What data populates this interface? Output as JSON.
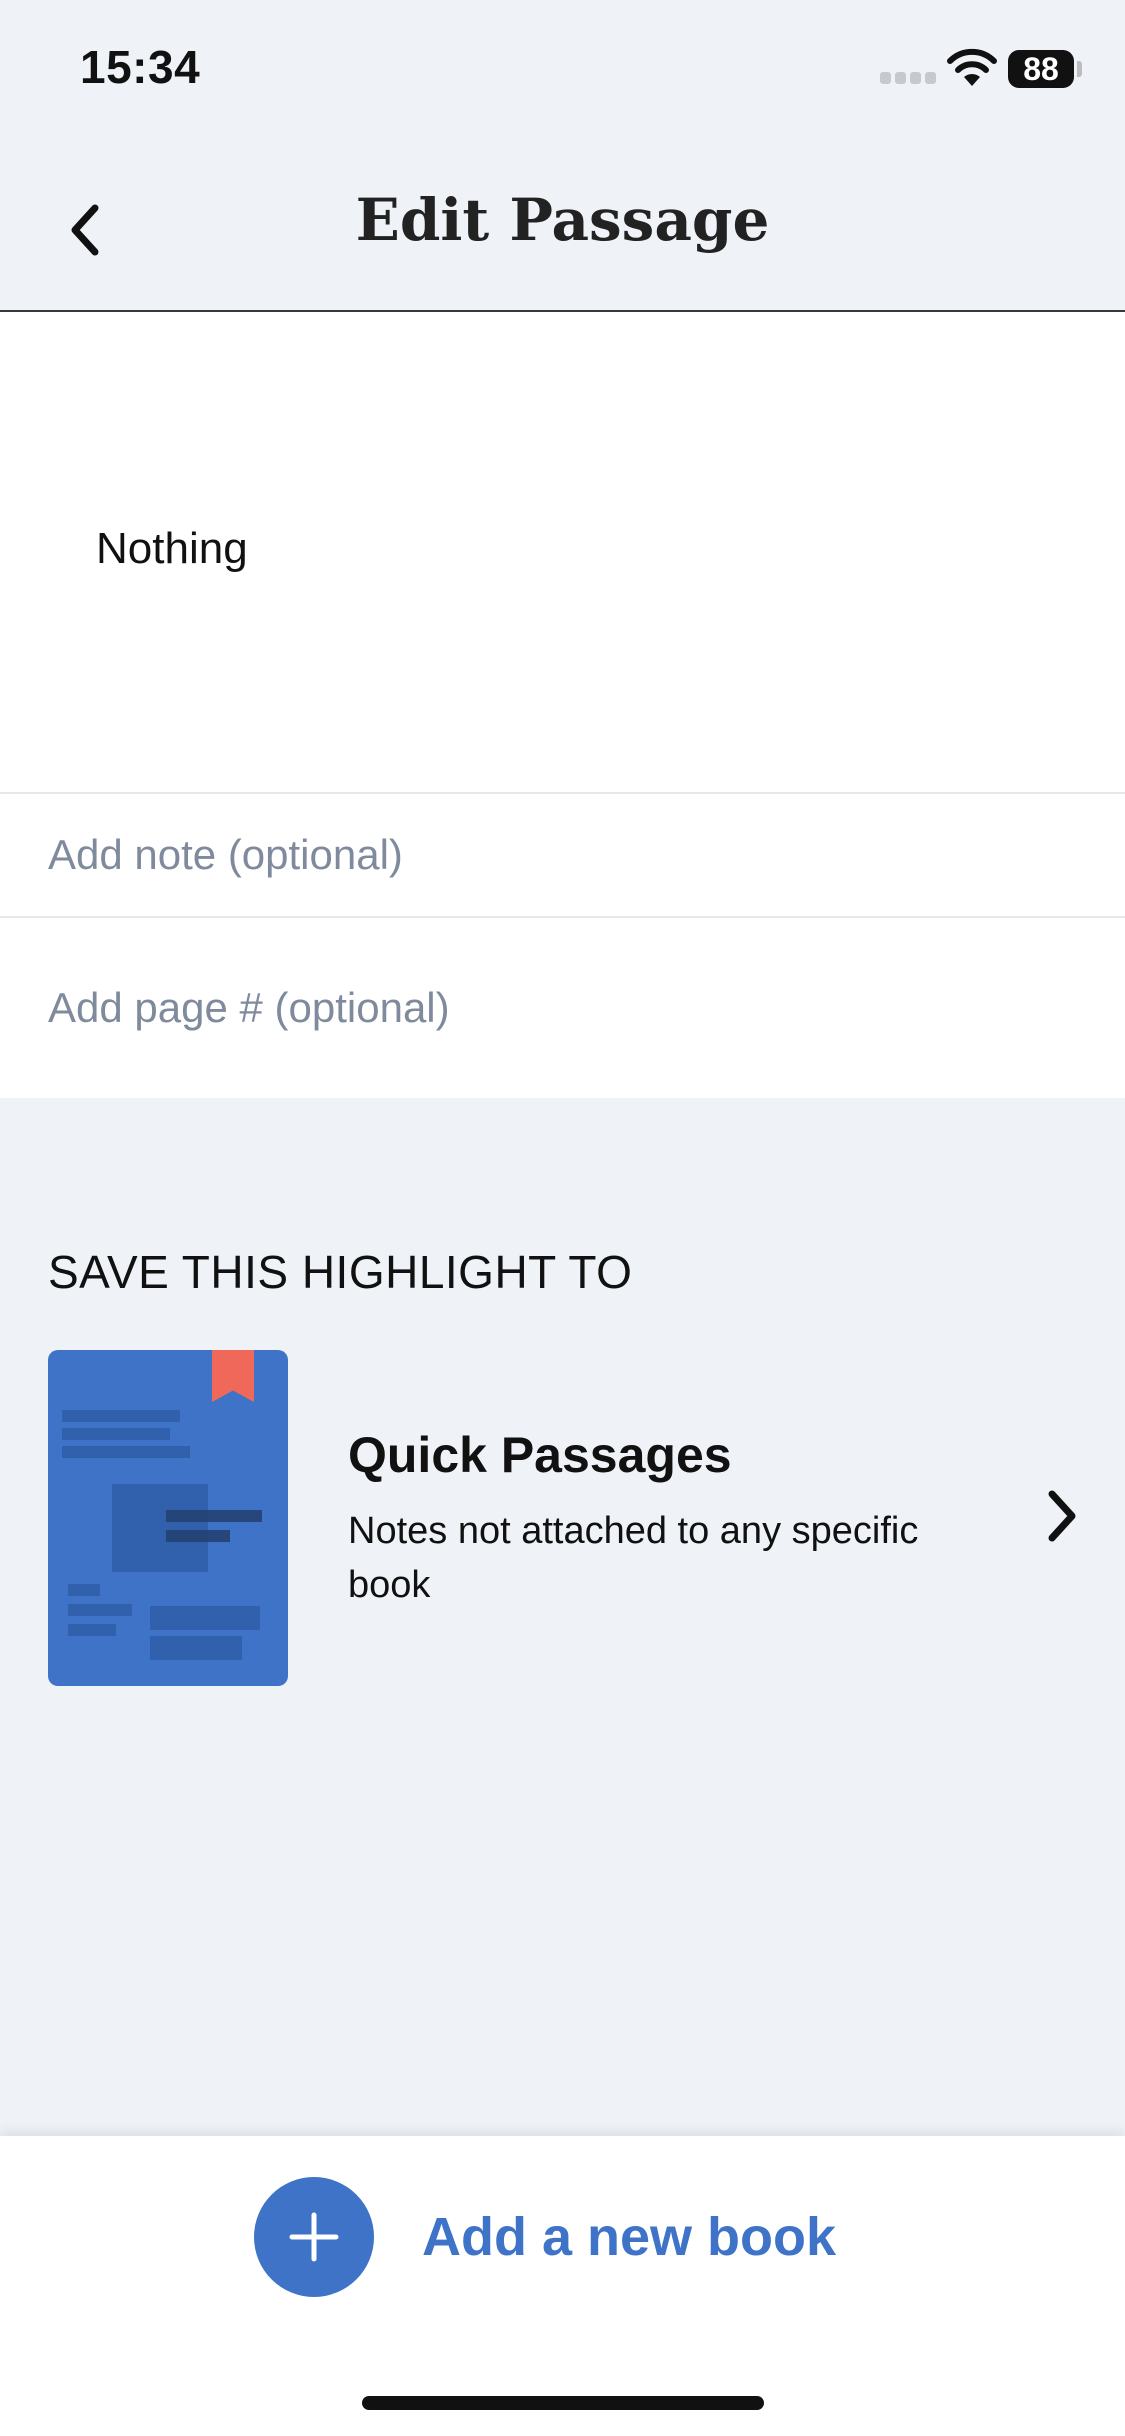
{
  "status_bar": {
    "time": "15:34",
    "battery": "88"
  },
  "nav": {
    "title": "Edit Passage"
  },
  "passage": {
    "text": "Nothing"
  },
  "fields": {
    "note_placeholder": "Add note (optional)",
    "page_placeholder": "Add page # (optional)"
  },
  "save_section": {
    "label": "SAVE THIS HIGHLIGHT TO",
    "book": {
      "title": "Quick Passages",
      "description": "Notes not attached to any specific book"
    }
  },
  "bottom": {
    "add_book_label": "Add a new book"
  },
  "colors": {
    "accent": "#3f73c8",
    "bookmark": "#f0685a",
    "background": "#eff3f8"
  }
}
